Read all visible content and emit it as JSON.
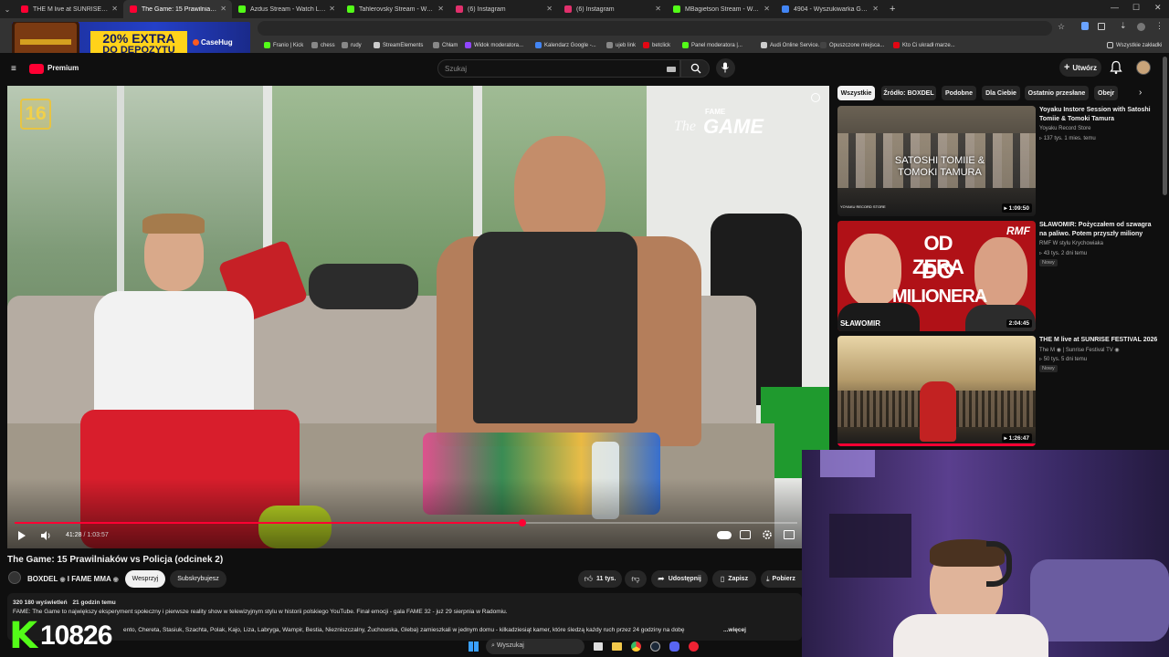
{
  "browser": {
    "tabs": [
      {
        "label": "THE M live at SUNRISE FESTIVAL",
        "color": "#ff0033",
        "active": false
      },
      {
        "label": "The Game: 15 Prawilniaków vs",
        "color": "#ff0033",
        "active": true
      },
      {
        "label": "Azdus Stream - Watch Live on",
        "color": "#53fc18",
        "active": false
      },
      {
        "label": "Tahlerovsky Stream - Watch Live",
        "color": "#53fc18",
        "active": false
      },
      {
        "label": "(6) Instagram",
        "color": "#e1306c",
        "active": false
      },
      {
        "label": "(6) Instagram",
        "color": "#e1306c",
        "active": false
      },
      {
        "label": "MBagietson Stream - Watch Live",
        "color": "#53fc18",
        "active": false
      },
      {
        "label": "4904 - Wyszukiwarka Google",
        "color": "#4285f4",
        "active": false
      }
    ],
    "new_tab": "+",
    "bookmarks": [
      {
        "label": "Franio | Kick",
        "color": "#53fc18"
      },
      {
        "label": "chess",
        "color": "#888888"
      },
      {
        "label": "rudy",
        "color": "#888888"
      },
      {
        "label": "StreamElements",
        "color": "#cccccc"
      },
      {
        "label": "Chłam",
        "color": "#888888"
      },
      {
        "label": "Widok moderatora...",
        "color": "#9146ff"
      },
      {
        "label": "Kalendarz Google -...",
        "color": "#4285f4"
      },
      {
        "label": "ujeb link",
        "color": "#888888"
      },
      {
        "label": "betclick",
        "color": "#e30613"
      },
      {
        "label": "Panel moderatora |...",
        "color": "#53fc18"
      },
      {
        "label": "Audi Online Service...",
        "color": "#cccccc"
      },
      {
        "label": "Opuszczone miejsca...",
        "color": "#444444"
      },
      {
        "label": "Kto Ci ukradł marze...",
        "color": "#e30613"
      }
    ],
    "bookmarks_folder": "Wszystkie zakładki"
  },
  "ad": {
    "promo_line1": "20% EXTRA",
    "promo_line2": "DO DEPOZYTU",
    "brand": "CaseHug"
  },
  "youtube": {
    "logo_label": "Premium",
    "search_placeholder": "Szukaj",
    "create_label": "Utwórz",
    "player": {
      "time_current": "41:28",
      "time_total": "1:03:57",
      "progress": 0.6486,
      "age_badge": "16",
      "watermark_top": "FAME",
      "watermark_bottom": "GAME",
      "watermark_script": "The"
    },
    "video": {
      "title": "The Game: 15 Prawilniaków vs Policja (odcinek 2)",
      "channel": "BOXDEL",
      "channel_secondary": "I FAME MMA",
      "support_label": "Wesprzyj",
      "subscribed_label": "Subskrybujesz",
      "likes": "11 tys.",
      "share_label": "Udostępnij",
      "save_label": "Zapisz",
      "download_label": "Pobierz",
      "views": "320 180 wyświetleń",
      "published": "21 godzin temu",
      "description_line1": "FAME: The Game to największy eksperyment społeczny i pierwsze reality show w telewizyjnym stylu w historii polskiego YouTube. Finał emocji - gala FAME 32 - już 29 sierpnia w Radomiu.",
      "description_line2": "ento, Chereta, Stasiuk, Szachta, Polak, Kajo, Liza, Labryga, Wampir, Bestia, Niezniszczalny, Żuchowska, Gleba) zamieszkali w jednym domu - kilkadziesiąt kamer, które śledzą każdy ruch przez 24 godziny na dobę",
      "more_label": "...więcej"
    },
    "chips": [
      "Wszystkie",
      "Źródło: BOXDEL",
      "Podobne",
      "Dla Ciebie",
      "Ostatnio przesłane",
      "Obejr"
    ],
    "related": [
      {
        "title": "Yoyaku Instore Session with Satoshi Tomiie & Tomoki Tamura",
        "channel": "Yoyaku Record Store",
        "meta": "137 tys.   1 mies. temu",
        "duration": "1:09:50",
        "thumb_text": "SATOSHI TOMIIE & TOMOKI TAMURA",
        "thumb_small": "YOYAKU RECORD STORE",
        "badge": ""
      },
      {
        "title": "SŁAWOMIR: Pożyczałem od szwagra na paliwo. Potem przyszły miliony",
        "channel": "RMF W stylu Krychowiaka",
        "meta": "43 tys.   2 dni temu",
        "duration": "2:04:45",
        "thumb_text_1": "OD ZERA",
        "thumb_text_2": "DO",
        "thumb_text_3": "MILIONERA",
        "thumb_small": "SŁAWOMIR",
        "thumb_logo": "RMF",
        "badge": "Nowy"
      },
      {
        "title": "THE M live at SUNRISE FESTIVAL 2026",
        "channel": "The M",
        "channel_suffix": "| Sunrise Festival TV",
        "meta": "50 tys.   5 dni temu",
        "duration": "1:26:47",
        "badge": "Nowy"
      }
    ]
  },
  "overlay": {
    "kick_letter": "K",
    "kick_count": "10826"
  },
  "taskbar": {
    "search_placeholder": "Wyszukaj"
  },
  "colors": {
    "accent_red": "#ff0033",
    "kick_green": "#53fc18",
    "bg": "#0f0f0f"
  }
}
